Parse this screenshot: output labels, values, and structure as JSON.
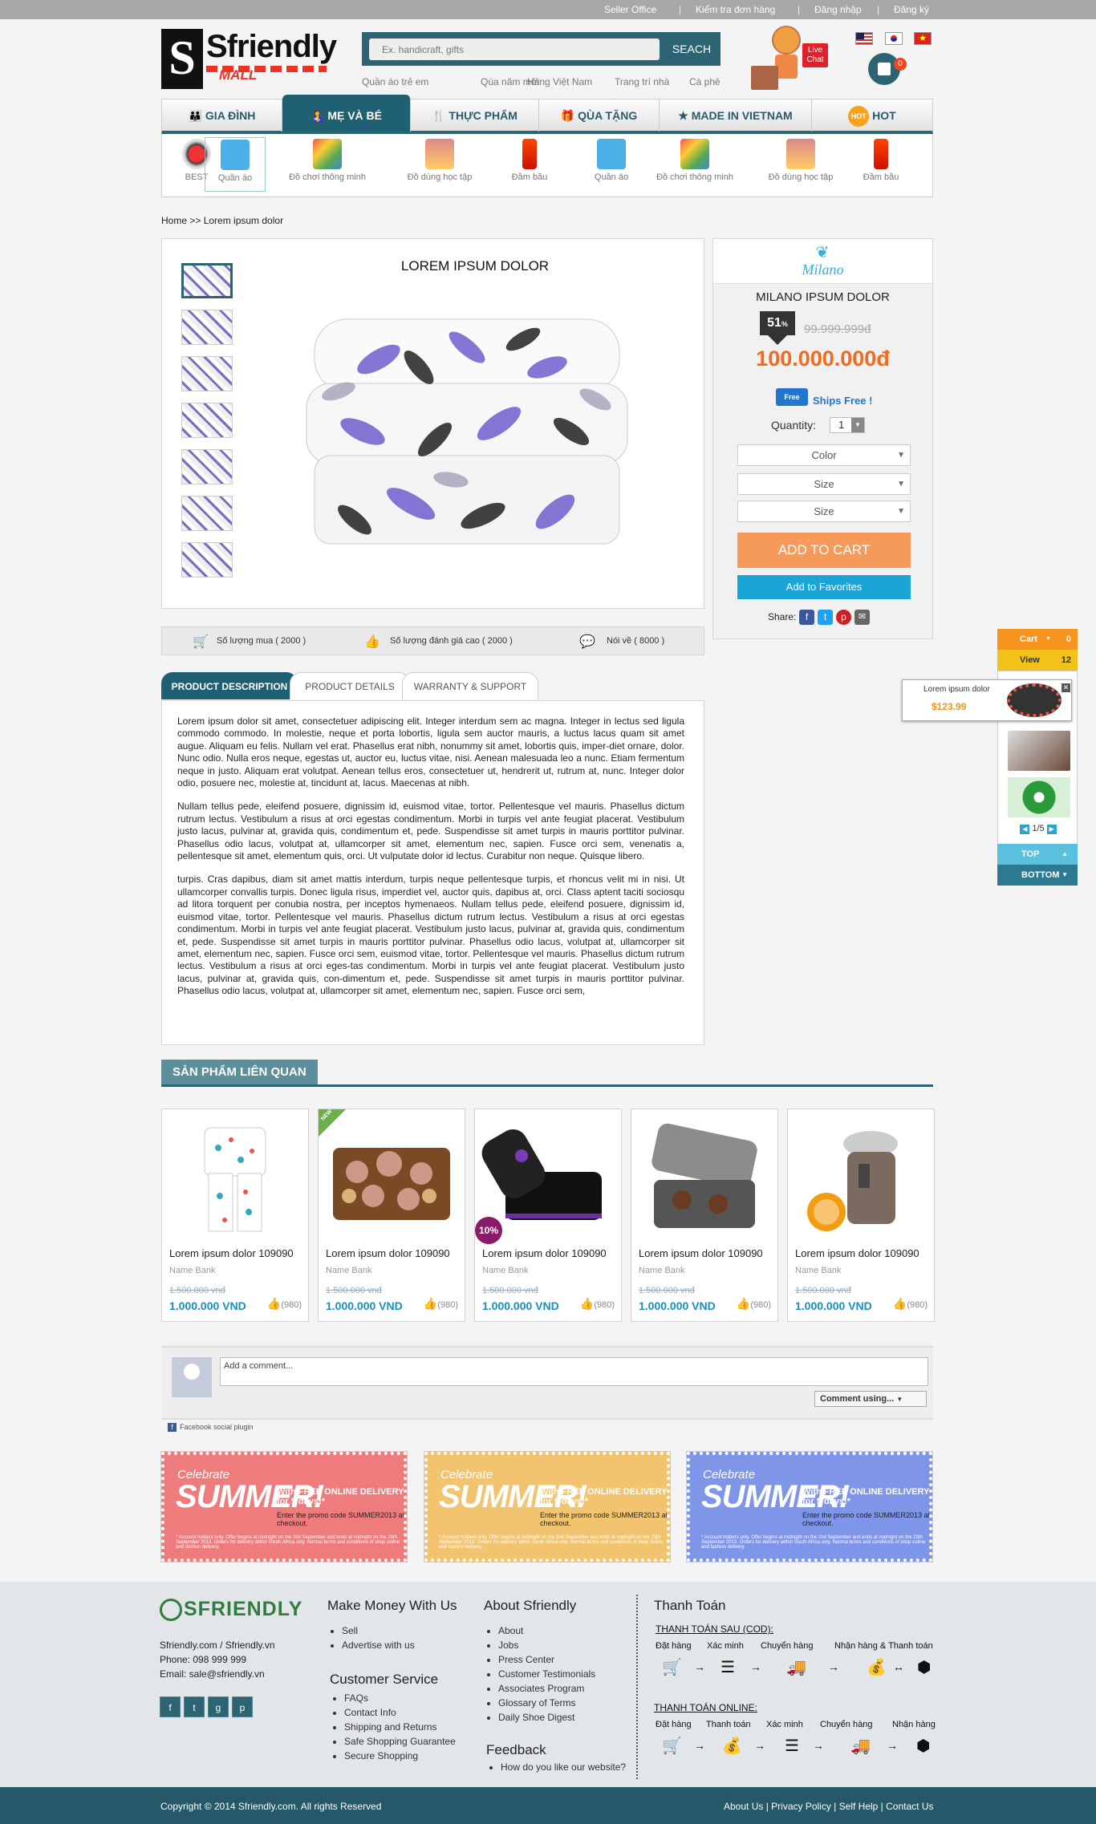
{
  "topbar": {
    "items": [
      "Seller  Office",
      "Kiểm tra đơn hàng",
      "Đăng nhập",
      "Đăng ký"
    ],
    "sep": "|"
  },
  "logo": {
    "main": "Sfriendly",
    "sub": "MALL"
  },
  "search": {
    "placeholder": "Ex. handicraft, gifts",
    "button": "SEACH",
    "suggestions": [
      "Quần áo trẻ em",
      "Qùa năm mới",
      "Hàng Việt Nam",
      "Trang trí nhà",
      "Cà phê"
    ]
  },
  "chat": {
    "label": "Live Chat"
  },
  "cart_count": "0",
  "nav": {
    "items": [
      "GIA ĐÌNH",
      "MẸ VÀ BÉ",
      "THỰC PHẨM",
      "QÙA TẶNG",
      "MADE IN VIETNAM",
      "HOT"
    ],
    "hot_badge": "HOT"
  },
  "subnav": {
    "items": [
      "BEST",
      "Quần áo",
      "Đồ chơi thông minh",
      "Đồ dùng học tập",
      "Đầm bầu",
      "Quần áo",
      "Đồ chơi thông minh",
      "Đồ dùng học tập",
      "Đầm bầu"
    ]
  },
  "breadcrumb": "Home >> Lorem ipsum dolor",
  "product": {
    "title": "LOREM IPSUM DOLOR",
    "stats": [
      "Số lượng mua ( 2000 )",
      "Số lượng đánh giá cao ( 2000 )",
      "Nói về ( 8000 )"
    ]
  },
  "buybox": {
    "brand": "Milano",
    "name": "MILANO IPSUM DOLOR",
    "discount": "51",
    "discount_unit": "%",
    "old_price": "99.999.999đ",
    "price": "100.000.000đ",
    "ship_badge": "Free",
    "ship": "Ships Free !",
    "qty_label": "Quantity:",
    "qty": "1",
    "selects": [
      "Color",
      "Size",
      "Size"
    ],
    "add_cart": "ADD TO CART",
    "add_fav": "Add to Favorites",
    "share": "Share:"
  },
  "tabs": [
    "PRODUCT DESCRIPTION",
    "PRODUCT DETAILS",
    "WARRANTY & SUPPORT"
  ],
  "description": [
    "Lorem ipsum dolor sit amet, consectetuer adipiscing elit. Integer interdum sem ac magna. Integer in lectus sed ligula commodo commodo. In molestie, neque et porta lobortis, ligula sem auctor mauris, a luctus lacus quam sit amet augue. Aliquam eu felis. Nullam vel erat. Phasellus erat nibh, nonummy sit amet, lobortis quis, imper-diet ornare, dolor. Nunc odio. Nulla eros neque, egestas ut, auctor eu, luctus vitae, nisi. Aenean malesuada leo a nunc. Etiam fermentum neque in justo. Aliquam erat volutpat. Aenean tellus eros, consectetuer ut, hendrerit ut, rutrum at, nunc. Integer dolor odio, posuere nec, molestie at, tincidunt at, lacus. Maecenas at nibh.",
    "Nullam tellus pede, eleifend posuere, dignissim id, euismod vitae, tortor. Pellentesque vel mauris. Phasellus dictum rutrum lectus. Vestibulum a risus at orci egestas condimentum. Morbi in turpis vel ante feugiat placerat. Vestibulum justo lacus, pulvinar at, gravida quis, condimentum et, pede. Suspendisse sit amet turpis in mauris porttitor pulvinar. Phasellus odio lacus, volutpat at, ullamcorper sit amet, elementum nec, sapien. Fusce orci sem, venenatis a, pellentesque sit amet, elementum quis, orci. Ut vulputate dolor id lectus. Curabitur non neque. Quisque libero.",
    "turpis. Cras dapibus, diam sit amet mattis interdum, turpis neque pellentesque turpis, et rhoncus velit mi in nisi. Ut ullamcorper convallis turpis. Donec ligula risus, imperdiet vel, auctor quis, dapibus at, orci. Class aptent taciti sociosqu ad litora torquent per conubia nostra, per inceptos hymenaeos. Nullam tellus pede, eleifend posuere, dignissim id, euismod vitae, tortor. Pellentesque vel mauris. Phasellus dictum rutrum lectus. Vestibulum a risus at orci egestas condimentum. Morbi in turpis vel ante feugiat placerat. Vestibulum justo lacus, pulvinar at, gravida quis, condimentum et, pede. Suspendisse sit amet turpis in mauris porttitor pulvinar. Phasellus odio lacus, volutpat at, ullamcorper sit amet, elementum nec, sapien. Fusce orci sem, euismod vitae, tortor. Pellentesque vel mauris. Phasellus dictum rutrum lectus. Vestibulum a risus at orci eges-tas condimentum. Morbi in turpis vel ante feugiat placerat. Vestibulum justo lacus, pulvinar at, gravida quis, con-dimentum et, pede. Suspendisse sit amet turpis in mauris porttitor pulvinar. Phasellus odio lacus, volutpat at, ullamcorper sit amet, elementum nec, sapien. Fusce orci sem,"
  ],
  "related": {
    "title": "SẢN PHẨM LIÊN QUAN",
    "items": [
      {
        "name": "Lorem ipsum dolor 109090",
        "bank": "Name Bank",
        "old": "1.500.000 vnđ",
        "price": "1.000.000 VND",
        "likes": "(980)"
      },
      {
        "name": "Lorem ipsum dolor 109090",
        "bank": "Name Bank",
        "old": "1.500.000 vnđ",
        "price": "1.000.000 VND",
        "likes": "(980)",
        "badge": "NEW"
      },
      {
        "name": "Lorem ipsum dolor 109090",
        "bank": "Name Bank",
        "old": "1.500.000 vnđ",
        "price": "1.000.000 VND",
        "likes": "(980)",
        "badge": "10%"
      },
      {
        "name": "Lorem ipsum dolor 109090",
        "bank": "Name Bank",
        "old": "1.500.000 vnđ",
        "price": "1.000.000 VND",
        "likes": "(980)"
      },
      {
        "name": "Lorem ipsum dolor 109090",
        "bank": "Name Bank",
        "old": "1.500.000 vnđ",
        "price": "1.000.000 VND",
        "likes": "(980)"
      }
    ]
  },
  "comments": {
    "placeholder": "Add a comment...",
    "sort": "Comment using...",
    "plugin": "Facebook social plugin"
  },
  "promos": [
    {
      "cel": "Celebrate",
      "big": "SUMMER!",
      "r1": "With FREE ONLINE DELIVERY for 5 days!*",
      "r2": "Enter the promo code SUMMER2013 at checkout.",
      "r3": "* Account holders only. Offer begins at midnight on the 2nd September and ends at midnight on the 29th September 2013. Orders for delivery within South Africa only. Normal terms and conditions of shop online and fashion delivery.",
      "color": "#ee7c7c"
    },
    {
      "cel": "Celebrate",
      "big": "SUMMER!",
      "r1": "With FREE ONLINE DELIVERY for 5 days!*",
      "r2": "Enter the promo code SUMMER2013 at checkout.",
      "r3": "* Account holders only. Offer begins at midnight on the 2nd September and ends at midnight on the 29th September 2013. Orders for delivery within South Africa only. Normal terms and conditions of shop online and fashion delivery.",
      "color": "#f2c46f"
    },
    {
      "cel": "Celebrate",
      "big": "SUMMER!",
      "r1": "With FREE ONLINE DELIVERY for 5 days!*",
      "r2": "Enter the promo code SUMMER2013 at checkout.",
      "r3": "* Account holders only. Offer begins at midnight on the 2nd September and ends at midnight on the 29th September 2013. Orders for delivery within South Africa only. Normal terms and conditions of shop online and fashion delivery.",
      "color": "#7e95e8"
    }
  ],
  "footer": {
    "brand": "SFRIENDLY",
    "contact": [
      "Sfriendly.com / Sfriendly.vn",
      "Phone: 098 999 999",
      "Email: sale@sfriendly.vn"
    ],
    "col1_title": "Make Money With Us",
    "col1": [
      "Sell",
      "Advertise with us"
    ],
    "col2_title": "Customer Service",
    "col2": [
      "FAQs",
      "Contact Info",
      "Shipping and Returns",
      "Safe Shopping Guarantee",
      "Secure Shopping"
    ],
    "col3_title": "About Sfriendly",
    "col3": [
      "About",
      "Jobs",
      "Press Center",
      "Customer Testimonials",
      "Associates Program",
      "Glossary of Terms",
      "Daily Shoe Digest"
    ],
    "col4_title": "Feedback",
    "col4": [
      "How do you like our website?"
    ],
    "pay_title": "Thanh Toán",
    "cod_title": "THANH TOÁN SAU (COD):",
    "cod_steps": [
      "Đặt hàng",
      "Xác minh",
      "Chuyển hàng",
      "Nhận hàng & Thanh toán"
    ],
    "online_title": "THANH TOÁN ONLINE:",
    "online_steps": [
      "Đặt hàng",
      "Thanh toán",
      "Xác minh",
      "Chuyển hàng",
      "Nhận hàng"
    ]
  },
  "copyright": "Copyright © 2014 Sfriendly.com. All rights Reserved",
  "bottom_links": [
    "About Us",
    "Privacy Policy",
    "Self Help",
    "Contact Us"
  ],
  "sidebar": {
    "cart": "Cart",
    "cart_count": "0",
    "view": "View",
    "view_count": "12",
    "item_name": "Lorem ipsum dolor",
    "item_price": "$123.99",
    "pager": "1/5",
    "top": "TOP",
    "bottom": "BOTTOM"
  }
}
